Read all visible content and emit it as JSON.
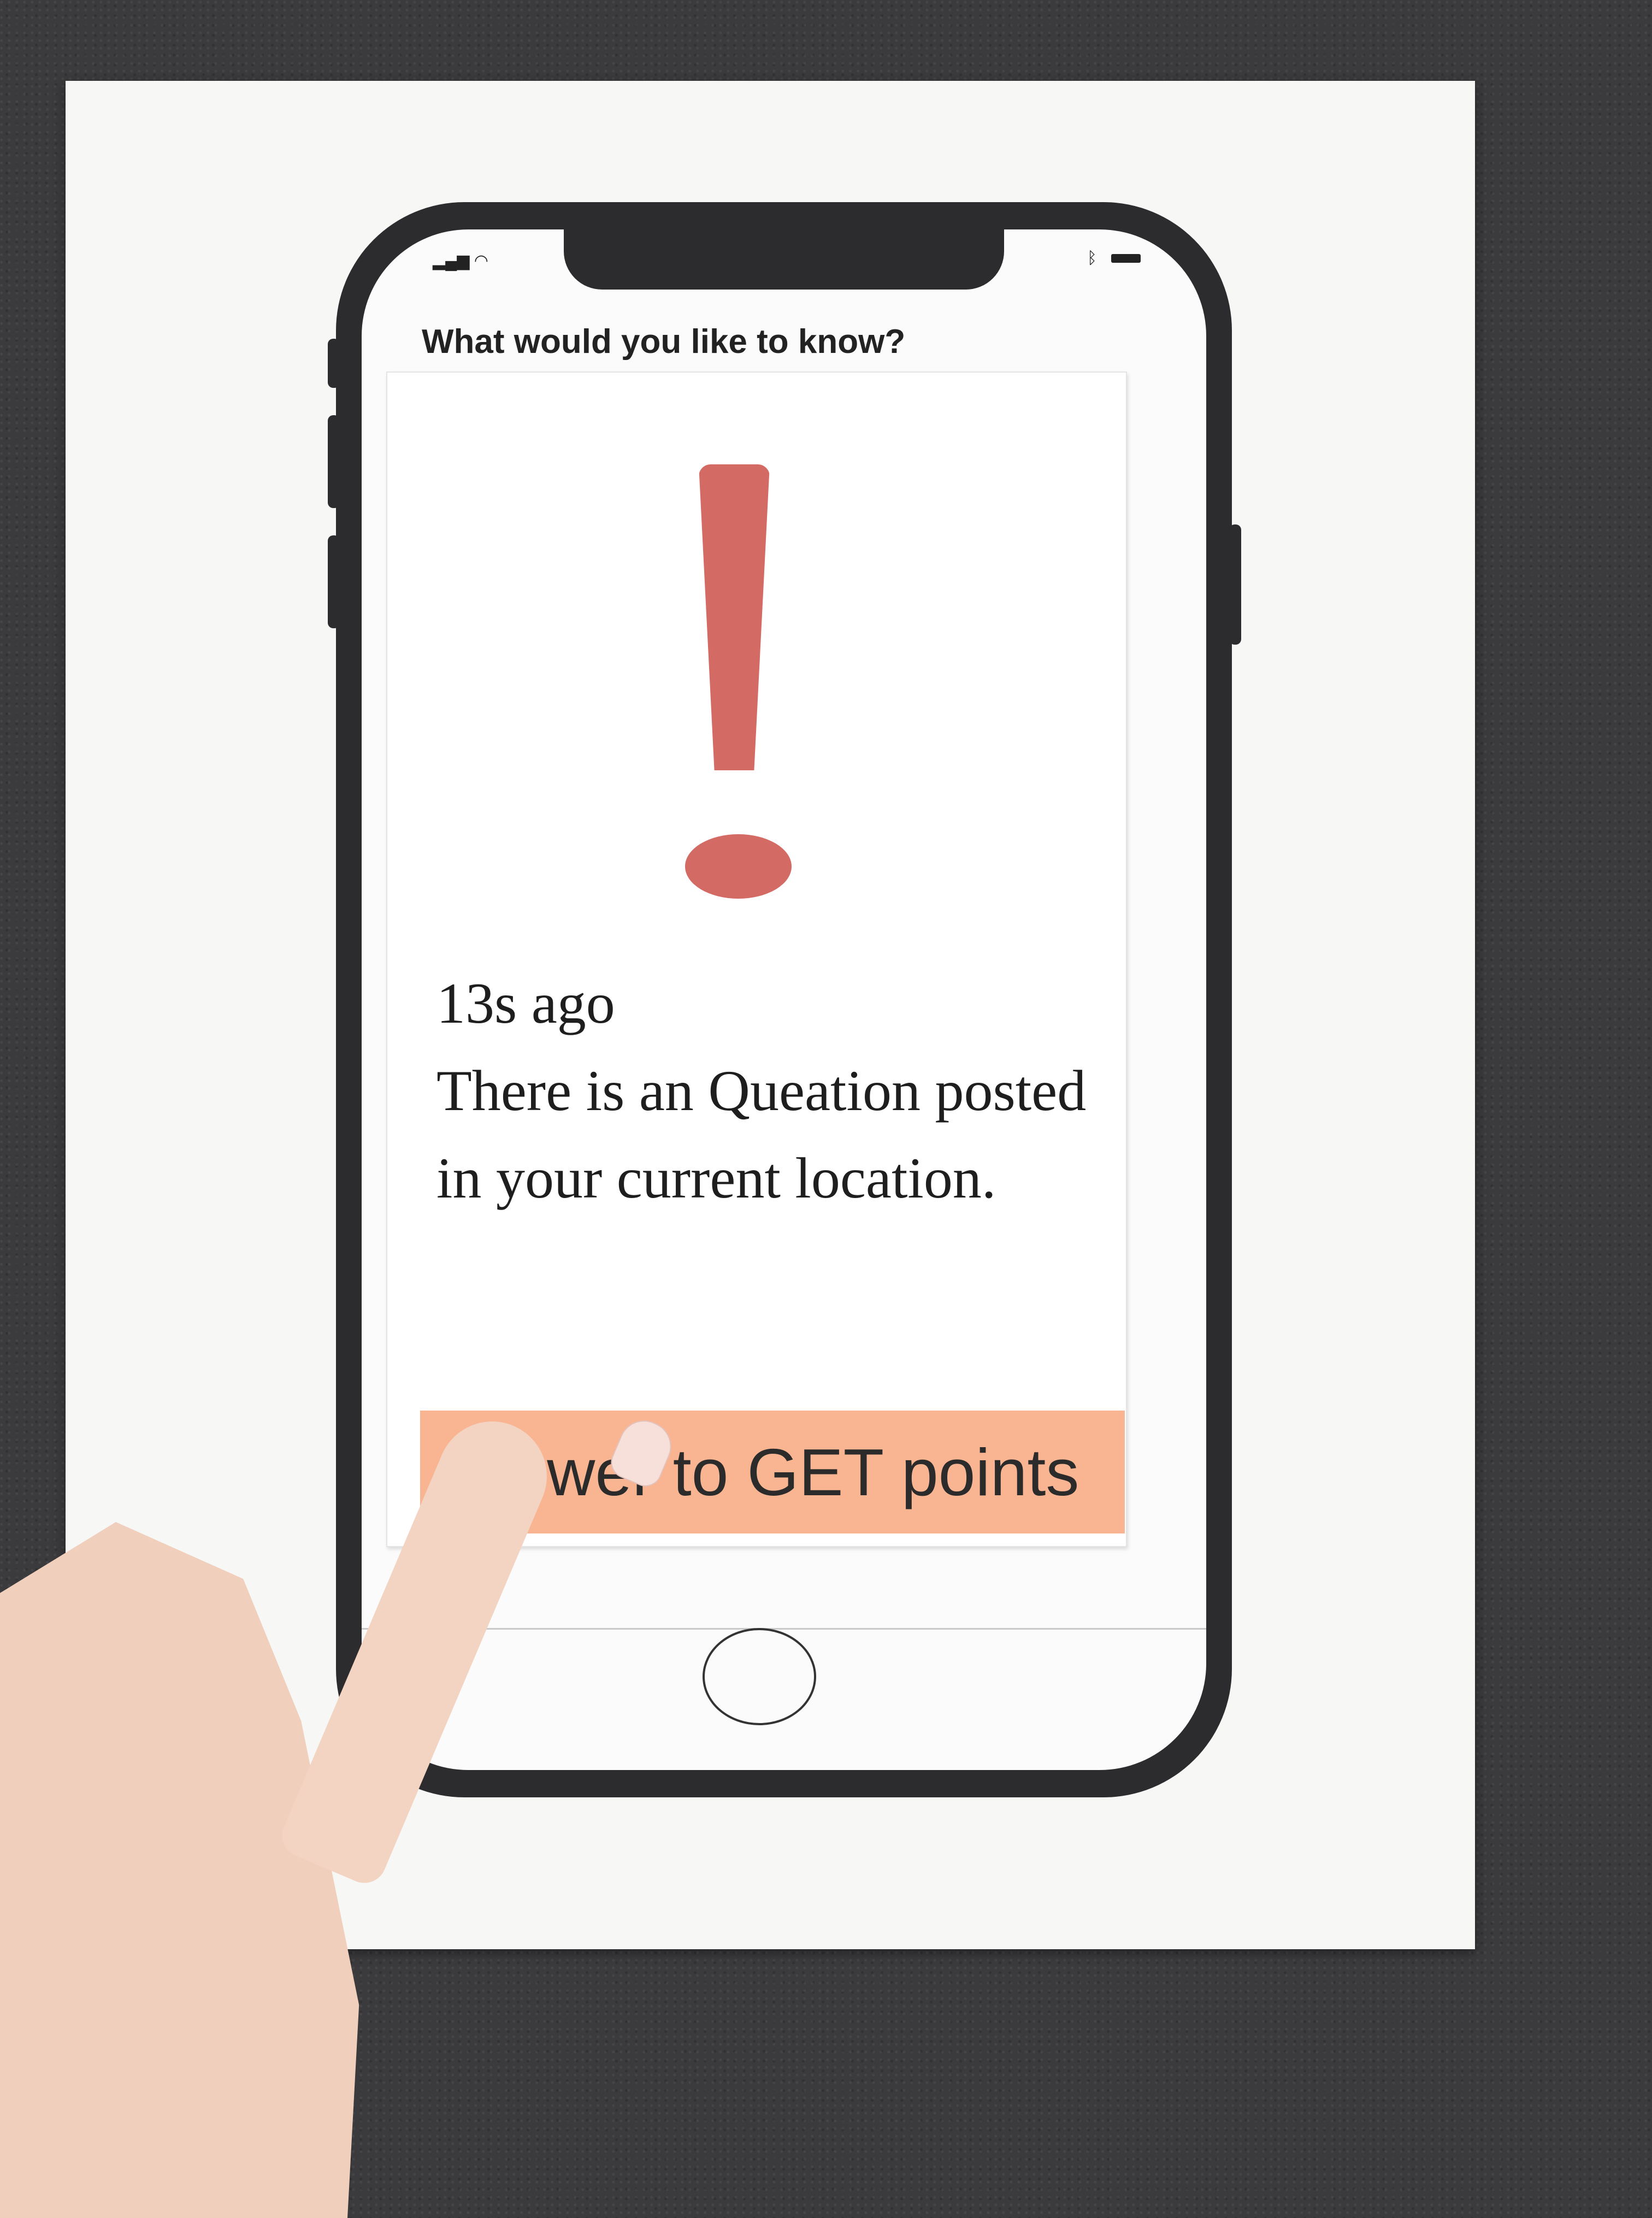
{
  "status_bar": {
    "signal_icon": "signal-bars-icon",
    "wifi_icon": "wifi-icon",
    "bluetooth_icon": "bluetooth-icon",
    "battery_icon": "battery-icon"
  },
  "header": {
    "title": "What would you like to know?"
  },
  "notification": {
    "icon": "exclamation-icon",
    "icon_color": "#d36a63",
    "time": "13s ago",
    "message": "There is an Queation posted in your current location."
  },
  "actions": {
    "answer_label": "Answer to GET points",
    "answer_color": "#f9b592"
  },
  "device": {
    "home_button_icon": "home-button-icon"
  }
}
